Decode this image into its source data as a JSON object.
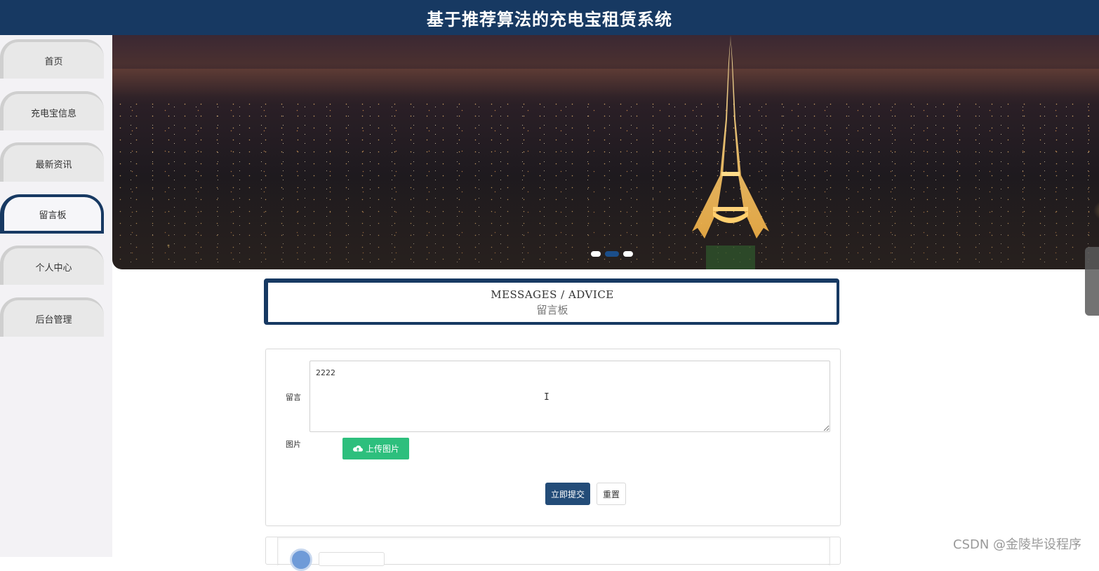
{
  "header": {
    "title": "基于推荐算法的充电宝租赁系统"
  },
  "sidebar": {
    "items": [
      {
        "label": "首页",
        "active": false
      },
      {
        "label": "充电宝信息",
        "active": false
      },
      {
        "label": "最新资讯",
        "active": false
      },
      {
        "label": "留言板",
        "active": true
      },
      {
        "label": "个人中心",
        "active": false
      },
      {
        "label": "后台管理",
        "active": false
      }
    ]
  },
  "banner": {
    "slide_count": 3,
    "active_slide": 2
  },
  "section": {
    "title_en": "MESSAGES / ADVICE",
    "title_cn": "留言板"
  },
  "form": {
    "message_label": "留言",
    "message_value": "2222",
    "image_label": "图片",
    "upload_label": "上传图片",
    "submit_label": "立即提交",
    "reset_label": "重置"
  },
  "watermark": "CSDN @金陵毕设程序",
  "colors": {
    "primary": "#173962",
    "upload": "#2dbf7d",
    "submit": "#234c78"
  }
}
